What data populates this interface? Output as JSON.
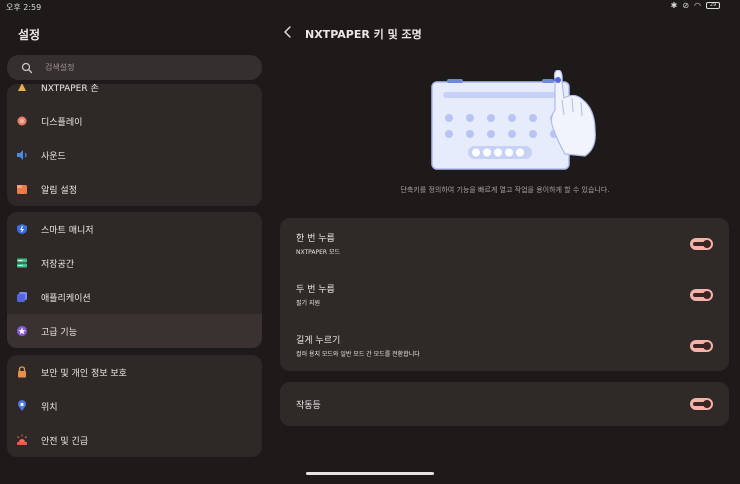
{
  "status": {
    "time": "오후 2:59",
    "battery": "29"
  },
  "left": {
    "title": "설정",
    "search_placeholder": "검색설정",
    "groups": [
      {
        "items": [
          {
            "label": "NXTPAPER 존",
            "icon": "nxtpaper-icon"
          },
          {
            "label": "디스플레이",
            "icon": "display-icon"
          },
          {
            "label": "사운드",
            "icon": "sound-icon"
          },
          {
            "label": "알림 설정",
            "icon": "notification-icon"
          }
        ]
      },
      {
        "items": [
          {
            "label": "스마트 매니저",
            "icon": "smart-manager-icon"
          },
          {
            "label": "저장공간",
            "icon": "storage-icon"
          },
          {
            "label": "애플리케이션",
            "icon": "apps-icon"
          },
          {
            "label": "고급 기능",
            "icon": "advanced-features-icon"
          }
        ]
      },
      {
        "items": [
          {
            "label": "보안 및 개인 정보 보호",
            "icon": "lock-icon"
          },
          {
            "label": "위치",
            "icon": "location-icon"
          },
          {
            "label": "안전 및 긴급",
            "icon": "emergency-icon"
          }
        ]
      }
    ]
  },
  "right": {
    "title": "NXTPAPER 키 및 조명",
    "description": "단축키를 정의하여 기능을 빠르게 열고 작업을 용이하게 할 수 있습니다.",
    "press_card": [
      {
        "title": "한 번 누름",
        "subtitle": "NXTPAPER 모드",
        "enabled": true
      },
      {
        "title": "두 번 누름",
        "subtitle": "필기 지원",
        "enabled": true
      },
      {
        "title": "길게 누르기",
        "subtitle": "컬러 용지 모드와 일반 모드 간 모드를 전환합니다",
        "enabled": true
      }
    ],
    "light_card": {
      "title": "작동등",
      "enabled": true
    }
  },
  "colors": {
    "background": "#1e1a1a",
    "card": "#2f2928",
    "toggle_on": "#f4b3aa"
  }
}
